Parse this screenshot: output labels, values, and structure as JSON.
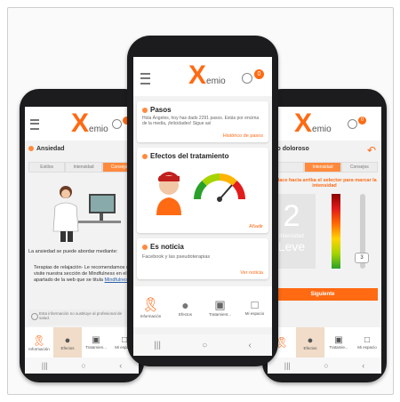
{
  "brand": {
    "x": "X",
    "emio": "emio",
    "accent": "#ff6a13"
  },
  "left_phone": {
    "section_title": "Ansiedad",
    "tabs": [
      "Estilos",
      "Intensidad",
      "Consejos"
    ],
    "intro": "La ansiedad se puede abordar mediante:",
    "bullet": "Terapias de relajación- Le recomendamos que visite nuestra sección de Mindfulness en el apartado de la web que se titula",
    "bullet_link": "Mindfulness",
    "footer_note": "Esta información no sustituye al profesional de salud.",
    "nav": [
      "Información",
      "Efectos",
      "Tratamien...",
      "Mi espacio"
    ]
  },
  "center_phone": {
    "badge": "0",
    "pasos": {
      "title": "Pasos",
      "text": "Hola Ángeles, hoy has dado 2291 pasos. Estás por encima de la media, ¡felicidades! Sigue así",
      "link": "Histórico de pasos"
    },
    "efectos": {
      "title": "Efectos del tratamiento",
      "link": "Añadir"
    },
    "noticia": {
      "title": "Es noticia",
      "text": "Facebook y las pseudoterapias",
      "link": "Ver noticia"
    },
    "nav": [
      "Información",
      "Efectos",
      "Tratamient...",
      "Mi espacio"
    ]
  },
  "right_phone": {
    "badge": "0",
    "section_title": "pito doloroso",
    "tabs": [
      "",
      "Intensidad",
      "Consejos"
    ],
    "instruction": "splace hacia arriba el selector para marcar la intensidad",
    "value": "2",
    "label1": "Intensidad",
    "label2": "Leve",
    "slider_value": "3",
    "button": "Siguiente",
    "nav": [
      "",
      "Efectos",
      "Tratamie...",
      "Mi espacio"
    ]
  }
}
